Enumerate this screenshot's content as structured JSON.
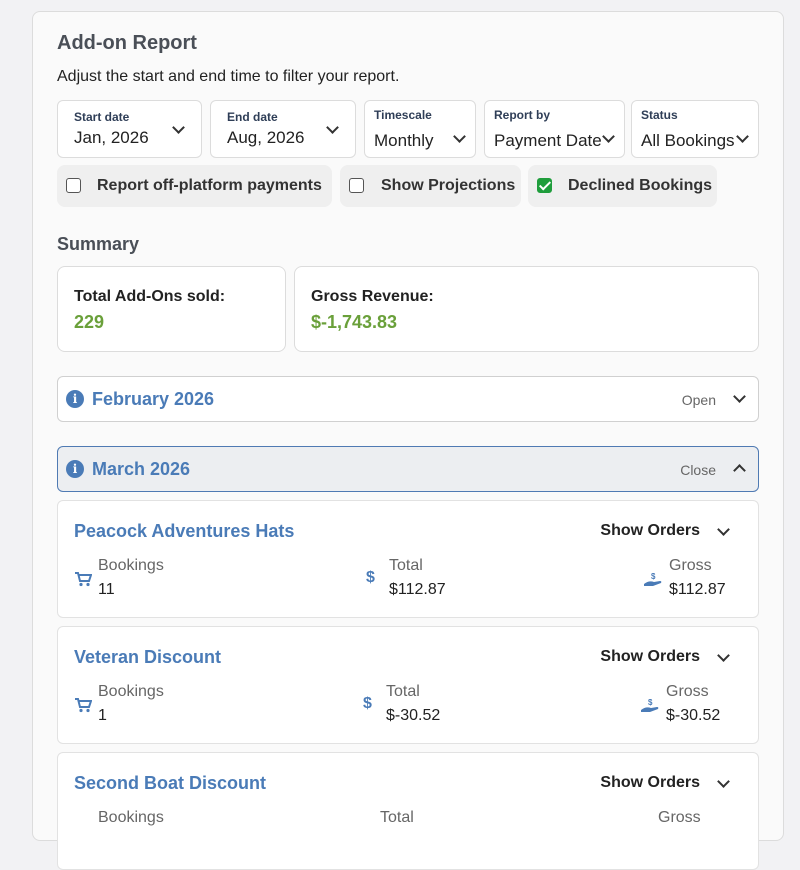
{
  "report": {
    "title": "Add-on Report",
    "subtitle": "Adjust the start and end time to filter your report."
  },
  "filters": {
    "start_date": {
      "label": "Start date",
      "value": "Jan, 2026"
    },
    "end_date": {
      "label": "End date",
      "value": "Aug, 2026"
    },
    "timescale": {
      "label": "Timescale",
      "value": "Monthly"
    },
    "report_by": {
      "label": "Report by",
      "value": "Payment Date"
    },
    "status": {
      "label": "Status",
      "value": "All Bookings"
    }
  },
  "checkboxes": {
    "off_platform": {
      "label": "Report off-platform payments",
      "checked": false
    },
    "projections": {
      "label": "Show Projections",
      "checked": false
    },
    "declined": {
      "label": "Declined Bookings",
      "checked": true
    }
  },
  "summary": {
    "title": "Summary",
    "total_label": "Total Add-Ons sold:",
    "total_value": "229",
    "gross_label": "Gross Revenue:",
    "gross_value": "$-1,743.83"
  },
  "months": [
    {
      "name": "February 2026",
      "toggle": "Open"
    },
    {
      "name": "March 2026",
      "toggle": "Close"
    }
  ],
  "items": [
    {
      "name": "Peacock Adventures Hats",
      "show_orders": "Show Orders",
      "bookings_label": "Bookings",
      "bookings": "11",
      "total_label": "Total",
      "total": "$112.87",
      "gross_label": "Gross",
      "gross": "$112.87"
    },
    {
      "name": "Veteran Discount",
      "show_orders": "Show Orders",
      "bookings_label": "Bookings",
      "bookings": "1",
      "total_label": "Total",
      "total": "$-30.52",
      "gross_label": "Gross",
      "gross": "$-30.52"
    },
    {
      "name": "Second Boat Discount",
      "show_orders": "Show Orders",
      "bookings_label": "Bookings",
      "total_label": "Total",
      "gross_label": "Gross"
    }
  ],
  "icons": {
    "cart": "cart-icon",
    "dollar": "dollar-icon",
    "gross": "hand-money-icon",
    "info": "info-icon"
  },
  "colors": {
    "accent_blue": "#4a7bb7",
    "positive_green": "#6aa03a",
    "checkbox_green": "#1f9d3c"
  }
}
